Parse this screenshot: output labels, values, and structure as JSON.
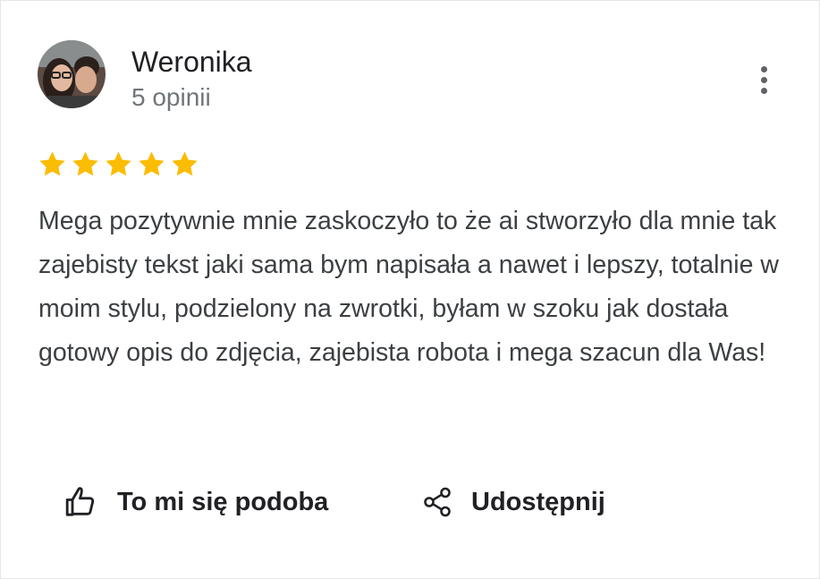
{
  "review": {
    "author_name": "Weronika",
    "review_count": "5 opinii",
    "rating": 5,
    "rating_max": 5,
    "text": "Mega pozytywnie mnie zaskoczyło to że ai stworzyło dla mnie tak zajebisty tekst jaki sama bym napisała a nawet i lepszy, totalnie w moim stylu, podzielony na zwrotki, byłam w szoku jak dostała gotowy opis do zdjęcia, zajebista robota i mega szacun dla Was!"
  },
  "actions": {
    "like_label": "To mi się podoba",
    "share_label": "Udostępnij"
  },
  "icons": {
    "avatar": "avatar-photo",
    "more": "more-vert-icon",
    "star": "star-icon",
    "like": "thumb-up-icon",
    "share": "share-icon"
  },
  "colors": {
    "star": "#fbbc04",
    "text_primary": "#202124",
    "text_secondary": "#70757a",
    "icon": "#5f6368"
  }
}
